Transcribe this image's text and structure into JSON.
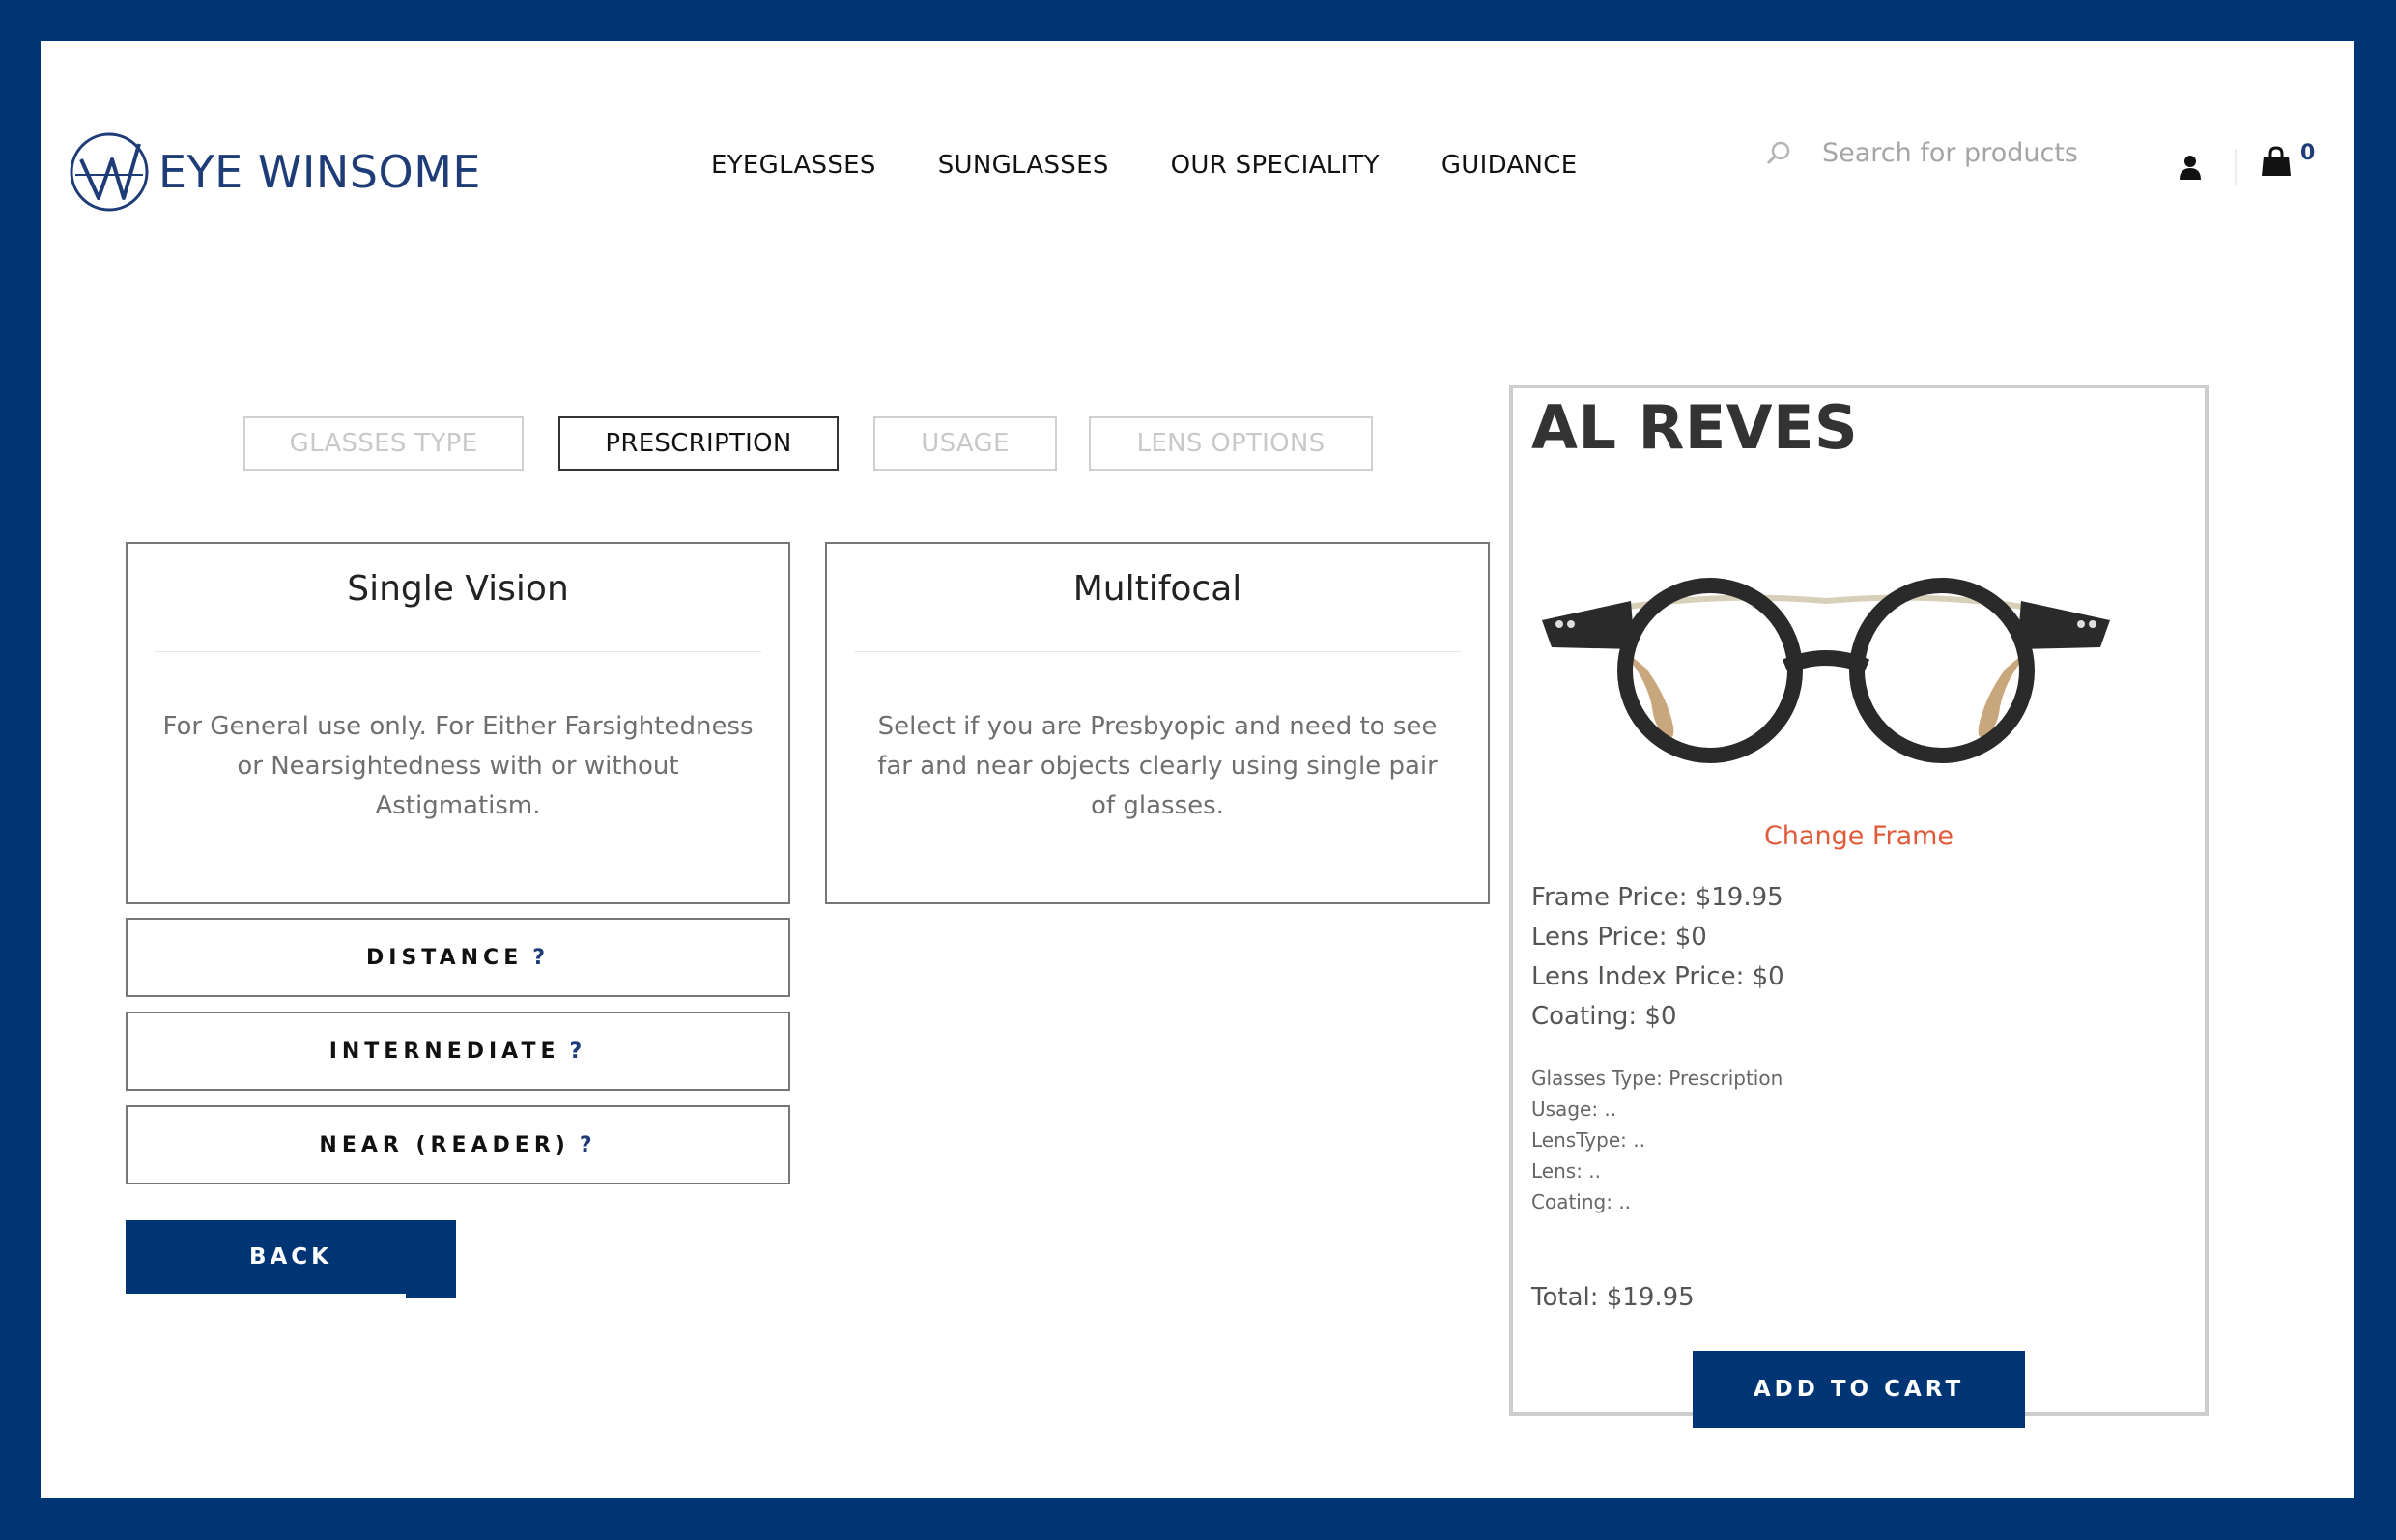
{
  "header": {
    "logo_text": "EYE WINSOME",
    "nav": [
      "EYEGLASSES",
      "SUNGLASSES",
      "OUR SPECIALITY",
      "GUIDANCE"
    ],
    "search_placeholder": "Search for products",
    "cart_count": "0",
    "icons": [
      "search-icon",
      "user-icon",
      "cart-bag-icon"
    ]
  },
  "steps": [
    {
      "label": "GLASSES TYPE",
      "active": false
    },
    {
      "label": "PRESCRIPTION",
      "active": true
    },
    {
      "label": "USAGE",
      "active": false
    },
    {
      "label": "LENS OPTIONS",
      "active": false
    }
  ],
  "options": [
    {
      "title": "Single Vision",
      "lines": [
        "For General use only. For Either Farsightedness",
        "or Nearsightedness with or without",
        "Astigmatism."
      ]
    },
    {
      "title": "Multifocal",
      "lines": [
        "Select if you are Presbyopic and need to see",
        "far and near objects clearly using single pair",
        "of glasses."
      ]
    }
  ],
  "sub_options": [
    {
      "label": "DISTANCE",
      "help": "?"
    },
    {
      "label": "INTERNEDIATE",
      "help": "?"
    },
    {
      "label": "NEAR (READER)",
      "help": "?"
    }
  ],
  "back_label": "BACK",
  "summary": {
    "product_name": "AL REVES",
    "change_frame": "Change Frame",
    "prices": [
      "Frame Price: $19.95",
      "Lens Price: $0",
      "Lens Index Price: $0",
      "Coating: $0"
    ],
    "details": [
      "Glasses Type: Prescription",
      "Usage: ..",
      "LensType: ..",
      "Lens: ..",
      "Coating: .."
    ],
    "total": "Total: $19.95",
    "add_to_cart": "ADD TO CART"
  },
  "colors": {
    "brand_navy": "#003575",
    "accent_orange": "#e05a3a"
  }
}
